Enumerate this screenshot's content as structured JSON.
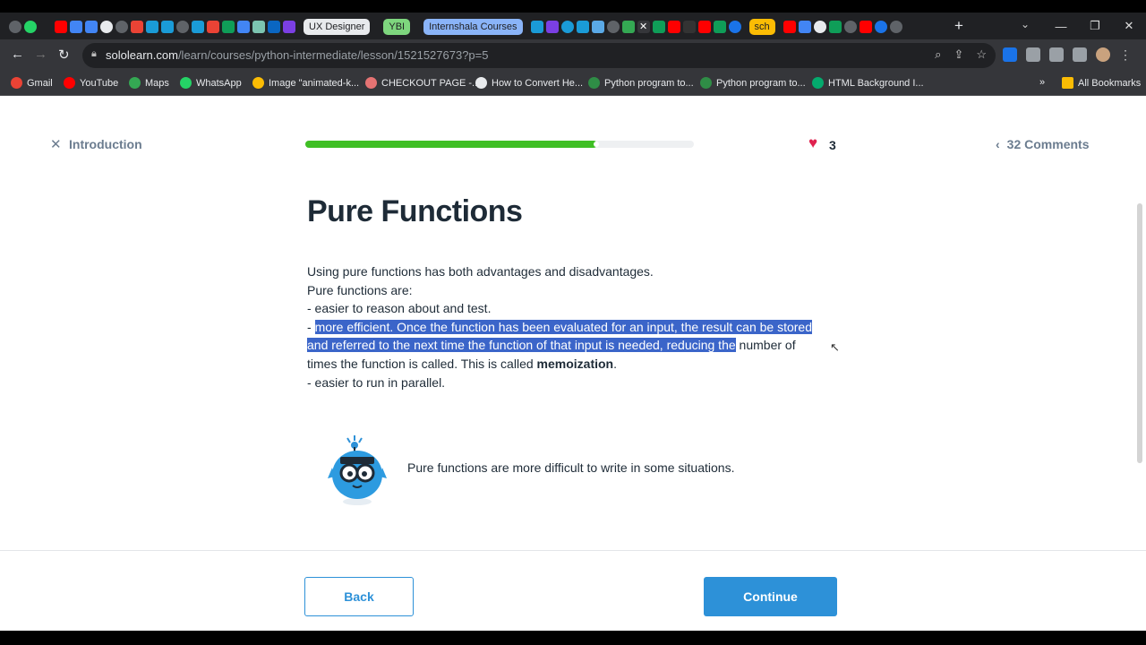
{
  "browser": {
    "tabs": [
      "UX Designer",
      "YBI",
      "Internshala Courses",
      "sch"
    ],
    "url_host": "sololearn.com",
    "url_path": "/learn/courses/python-intermediate/lesson/1521527673?p=5",
    "bookmarks": [
      "Gmail",
      "YouTube",
      "Maps",
      "WhatsApp",
      "Image \"animated-k...",
      "CHECKOUT PAGE -...",
      "How to Convert He...",
      "Python program to...",
      "Python program to...",
      "HTML Background I..."
    ],
    "all_bookmarks": "All Bookmarks"
  },
  "lesson": {
    "close_label": "Introduction",
    "progress": 0.75,
    "lives": "3",
    "comments": "32 Comments",
    "title": "Pure Functions",
    "line1": "Using pure functions has both advantages and disadvantages.",
    "line2": "Pure functions are:",
    "line3": "- easier to reason about and test.",
    "line4_prefix": "- ",
    "line4_selected": "more efficient. Once the function has been evaluated for an input, the result can be stored and referred to the next time the function of that input is needed, reducing the",
    "line4_rest": " number of times the function is called. This is called ",
    "line4_bold": "memoization",
    "line4_end": ".",
    "line5": "- easier to run in parallel.",
    "tip": "Pure functions are more difficult to write in some situations.",
    "back_label": "Back",
    "continue_label": "Continue"
  },
  "colors": {
    "accent": "#2d91d8",
    "progress": "#3fbf24",
    "heart": "#e0224f",
    "selection": "#3b65c9"
  }
}
